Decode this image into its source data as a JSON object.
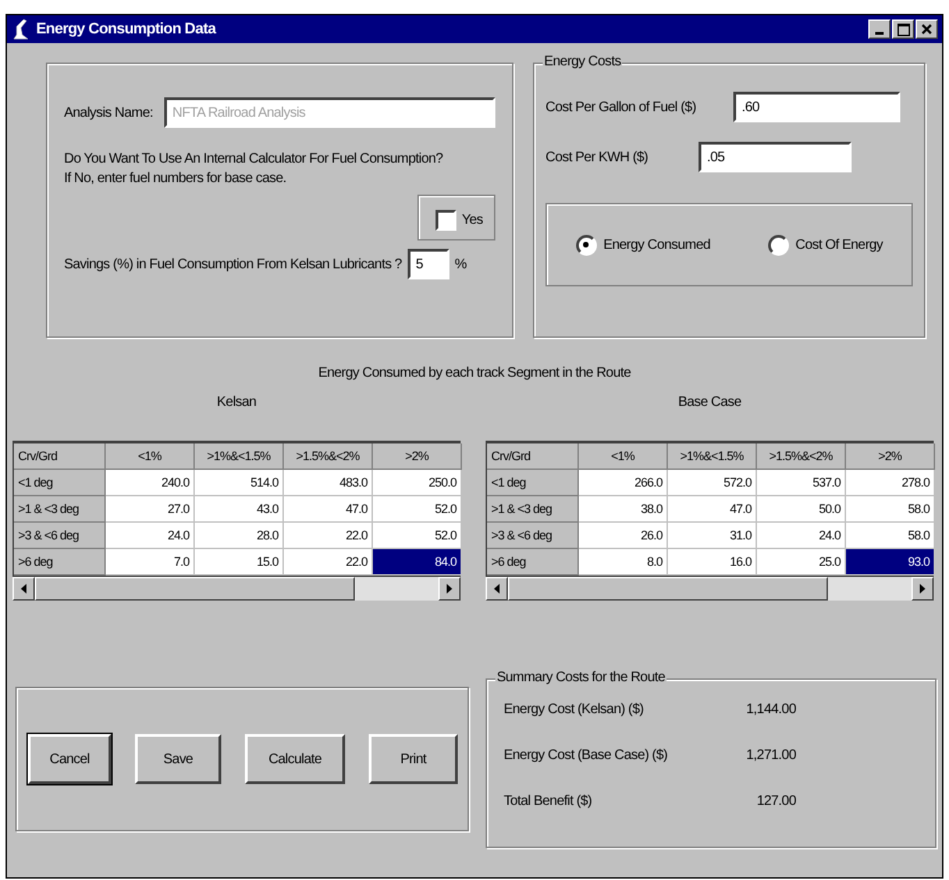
{
  "window": {
    "title": "Energy Consumption Data"
  },
  "analysis": {
    "name_label": "Analysis Name:",
    "name_value": "NFTA Railroad Analysis",
    "name_disabled": true,
    "question": "Do You Want To Use An Internal Calculator For Fuel Consumption?",
    "question_hint": "If No, enter fuel numbers for base case.",
    "calculator_checkbox": {
      "label": "Yes",
      "checked": false
    },
    "savings_label": "Savings (%) in Fuel Consumption From Kelsan Lubricants ?",
    "savings_value": "5",
    "savings_unit": "%"
  },
  "energy_costs": {
    "title": "Energy Costs",
    "fields": [
      {
        "label": "Cost Per Gallon of Fuel ($)",
        "value": ".60"
      },
      {
        "label": "Cost Per KWH ($)",
        "value": ".05"
      }
    ],
    "options": [
      {
        "label": "Energy Consumed",
        "selected": true
      },
      {
        "label": "Cost Of Energy",
        "selected": false
      }
    ]
  },
  "grids_title": "Energy Consumed by each track Segment in the Route",
  "grids": [
    {
      "title": "Kelsan",
      "corner": "Crv/Grd",
      "columns": [
        "<1%",
        ">1%&<1.5%",
        ">1.5%&<2%",
        ">2%"
      ],
      "rows": [
        {
          "label": "<1 deg",
          "cells": [
            {
              "text": "240.0",
              "selected": false
            },
            {
              "text": "514.0",
              "selected": false
            },
            {
              "text": "483.0",
              "selected": false
            },
            {
              "text": "250.0",
              "selected": false
            }
          ]
        },
        {
          "label": ">1 & <3 deg",
          "cells": [
            {
              "text": "27.0",
              "selected": false
            },
            {
              "text": "43.0",
              "selected": false
            },
            {
              "text": "47.0",
              "selected": false
            },
            {
              "text": "52.0",
              "selected": false
            }
          ]
        },
        {
          "label": ">3 & <6 deg",
          "cells": [
            {
              "text": "24.0",
              "selected": false
            },
            {
              "text": "28.0",
              "selected": false
            },
            {
              "text": "22.0",
              "selected": false
            },
            {
              "text": "52.0",
              "selected": false
            }
          ]
        },
        {
          "label": ">6 deg",
          "cells": [
            {
              "text": "7.0",
              "selected": false
            },
            {
              "text": "15.0",
              "selected": false
            },
            {
              "text": "22.0",
              "selected": false
            },
            {
              "text": "84.0",
              "selected": true
            }
          ]
        }
      ]
    },
    {
      "title": "Base Case",
      "corner": "Crv/Grd",
      "columns": [
        "<1%",
        ">1%&<1.5%",
        ">1.5%&<2%",
        ">2%"
      ],
      "rows": [
        {
          "label": "<1 deg",
          "cells": [
            {
              "text": "266.0",
              "selected": false
            },
            {
              "text": "572.0",
              "selected": false
            },
            {
              "text": "537.0",
              "selected": false
            },
            {
              "text": "278.0",
              "selected": false
            }
          ]
        },
        {
          "label": ">1 & <3 deg",
          "cells": [
            {
              "text": "38.0",
              "selected": false
            },
            {
              "text": "47.0",
              "selected": false
            },
            {
              "text": "50.0",
              "selected": false
            },
            {
              "text": "58.0",
              "selected": false
            }
          ]
        },
        {
          "label": ">3 & <6 deg",
          "cells": [
            {
              "text": "26.0",
              "selected": false
            },
            {
              "text": "31.0",
              "selected": false
            },
            {
              "text": "24.0",
              "selected": false
            },
            {
              "text": "58.0",
              "selected": false
            }
          ]
        },
        {
          "label": ">6 deg",
          "cells": [
            {
              "text": "8.0",
              "selected": false
            },
            {
              "text": "16.0",
              "selected": false
            },
            {
              "text": "25.0",
              "selected": false
            },
            {
              "text": "93.0",
              "selected": true
            }
          ]
        }
      ]
    }
  ],
  "buttons": [
    {
      "label": "Cancel",
      "default": true
    },
    {
      "label": "Save",
      "default": false
    },
    {
      "label": "Calculate",
      "default": false
    },
    {
      "label": "Print",
      "default": false
    }
  ],
  "summary": {
    "title": "Summary Costs for the Route",
    "items": [
      {
        "label": "Energy Cost (Kelsan) ($)",
        "value": "1,144.00"
      },
      {
        "label": "Energy Cost (Base Case) ($)",
        "value": "1,271.00"
      },
      {
        "label": "Total Benefit ($)",
        "value": "127.00"
      }
    ]
  }
}
